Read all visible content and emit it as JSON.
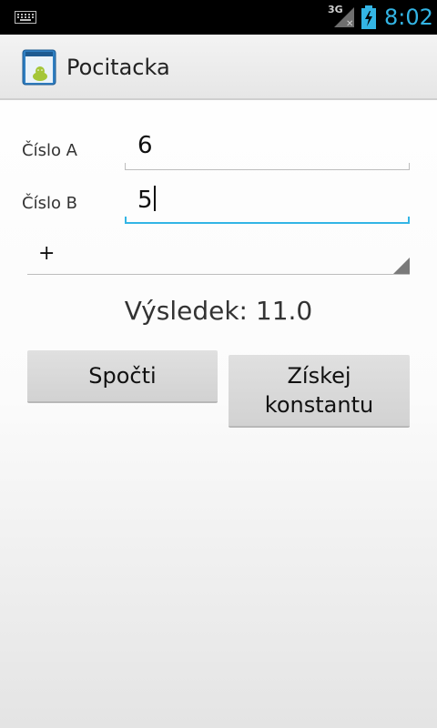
{
  "status_bar": {
    "network": "3G",
    "time": "8:02",
    "icons": [
      "keyboard-icon",
      "signal-icon",
      "battery-charging-icon"
    ]
  },
  "action_bar": {
    "title": "Pocitacka",
    "icon": "android-app-icon"
  },
  "form": {
    "a_label": "Číslo A",
    "a_value": "6",
    "b_label": "Číslo B",
    "b_value": "5",
    "operation": "+"
  },
  "result": "Výsledek: 11.0",
  "buttons": {
    "compute": "Spočti",
    "constant_line1": "Získej",
    "constant_line2": "konstantu"
  },
  "colors": {
    "accent": "#33b5e5",
    "statusbar": "#000000"
  }
}
